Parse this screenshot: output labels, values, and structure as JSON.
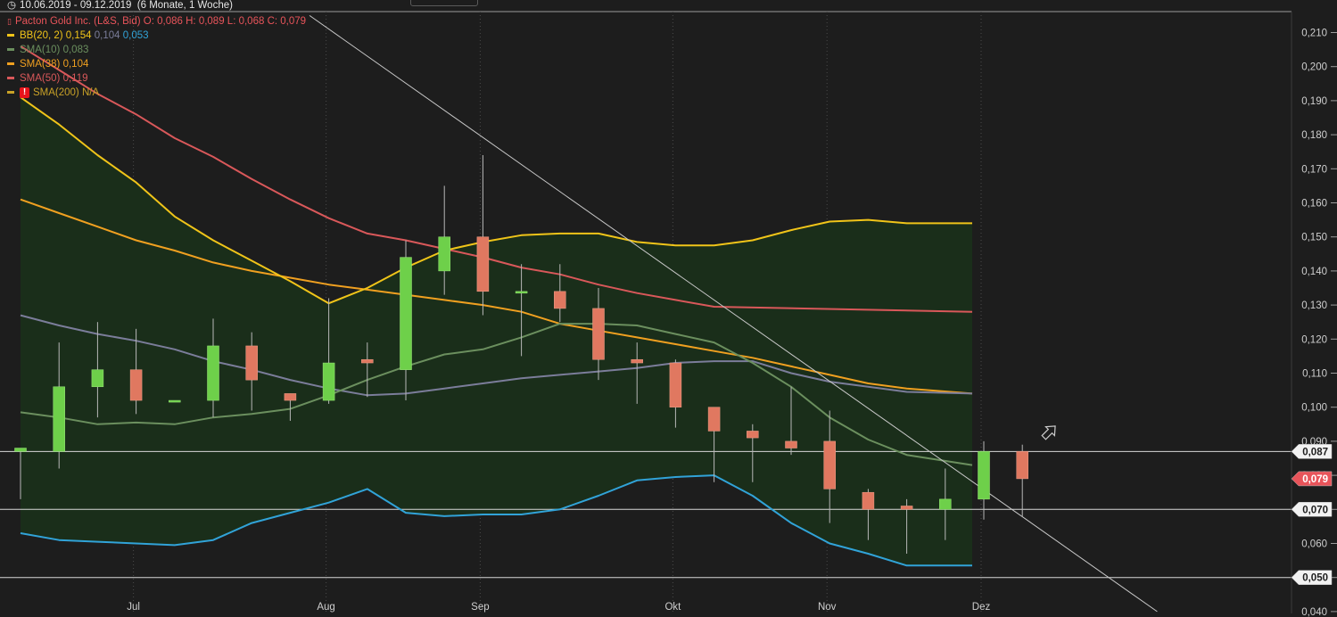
{
  "header": {
    "range_text": "10.06.2019 - 09.12.2019",
    "period_text": "(6 Monate, 1 Woche)"
  },
  "legend": {
    "instrument": {
      "name": "Pacton Gold Inc. (L&S, Bid)",
      "o_label": "O:",
      "o": "0,086",
      "h_label": "H:",
      "h": "0,089",
      "l_label": "L:",
      "l": "0,068",
      "c_label": "C:",
      "c": "0,079",
      "color": "#e8545a"
    },
    "bb": {
      "name": "BB(20, 2)",
      "v1": "0,154",
      "v2": "0,104",
      "v3": "0,053",
      "c1": "#f0c419",
      "c2": "#7b7d9a",
      "c3": "#31a3d8"
    },
    "sma10": {
      "name": "SMA(10)",
      "value": "0,083",
      "color": "#6b8f5e"
    },
    "sma38": {
      "name": "SMA(38)",
      "value": "0,104",
      "color": "#f0a020"
    },
    "sma50": {
      "name": "SMA(50)",
      "value": "0,119",
      "color": "#d9585a"
    },
    "sma200": {
      "name": "SMA(200)",
      "value": "N/A",
      "color": "#c9a227",
      "warn_icon": "!"
    }
  },
  "chart_data": {
    "type": "candlestick",
    "ylim": [
      0.04,
      0.215
    ],
    "y_ticks": [
      "0,210",
      "0,200",
      "0,190",
      "0,180",
      "0,170",
      "0,160",
      "0,150",
      "0,140",
      "0,130",
      "0,120",
      "0,110",
      "0,100",
      "0,090",
      "0,080",
      "0,070",
      "0,060",
      "0,050",
      "0,040"
    ],
    "y_tick_values": [
      0.21,
      0.2,
      0.19,
      0.18,
      0.17,
      0.16,
      0.15,
      0.14,
      0.13,
      0.12,
      0.11,
      0.1,
      0.09,
      0.08,
      0.07,
      0.06,
      0.05,
      0.04
    ],
    "x_labels": [
      {
        "label": "Jul",
        "index": 3.0
      },
      {
        "label": "Aug",
        "index": 8.0
      },
      {
        "label": "Sep",
        "index": 12.0
      },
      {
        "label": "Okt",
        "index": 17.0
      },
      {
        "label": "Nov",
        "index": 21.0
      },
      {
        "label": "Dez",
        "index": 25.0
      }
    ],
    "candles": [
      {
        "o": 0.087,
        "h": 0.088,
        "l": 0.073,
        "c": 0.088
      },
      {
        "o": 0.087,
        "h": 0.119,
        "l": 0.082,
        "c": 0.106
      },
      {
        "o": 0.106,
        "h": 0.125,
        "l": 0.097,
        "c": 0.111
      },
      {
        "o": 0.111,
        "h": 0.123,
        "l": 0.098,
        "c": 0.102
      },
      {
        "o": 0.102,
        "h": 0.102,
        "l": 0.102,
        "c": 0.102
      },
      {
        "o": 0.102,
        "h": 0.126,
        "l": 0.097,
        "c": 0.118
      },
      {
        "o": 0.118,
        "h": 0.122,
        "l": 0.099,
        "c": 0.108
      },
      {
        "o": 0.104,
        "h": 0.104,
        "l": 0.096,
        "c": 0.102
      },
      {
        "o": 0.102,
        "h": 0.132,
        "l": 0.101,
        "c": 0.113
      },
      {
        "o": 0.114,
        "h": 0.119,
        "l": 0.103,
        "c": 0.113
      },
      {
        "o": 0.111,
        "h": 0.149,
        "l": 0.102,
        "c": 0.144
      },
      {
        "o": 0.14,
        "h": 0.165,
        "l": 0.133,
        "c": 0.15
      },
      {
        "o": 0.15,
        "h": 0.174,
        "l": 0.127,
        "c": 0.134
      },
      {
        "o": 0.134,
        "h": 0.142,
        "l": 0.115,
        "c": 0.134
      },
      {
        "o": 0.134,
        "h": 0.142,
        "l": 0.125,
        "c": 0.129
      },
      {
        "o": 0.129,
        "h": 0.135,
        "l": 0.108,
        "c": 0.114
      },
      {
        "o": 0.114,
        "h": 0.119,
        "l": 0.101,
        "c": 0.113
      },
      {
        "o": 0.113,
        "h": 0.114,
        "l": 0.094,
        "c": 0.1
      },
      {
        "o": 0.1,
        "h": 0.1,
        "l": 0.078,
        "c": 0.093
      },
      {
        "o": 0.093,
        "h": 0.095,
        "l": 0.078,
        "c": 0.091
      },
      {
        "o": 0.09,
        "h": 0.106,
        "l": 0.086,
        "c": 0.088
      },
      {
        "o": 0.09,
        "h": 0.099,
        "l": 0.066,
        "c": 0.076
      },
      {
        "o": 0.075,
        "h": 0.076,
        "l": 0.061,
        "c": 0.07
      },
      {
        "o": 0.071,
        "h": 0.073,
        "l": 0.057,
        "c": 0.07
      },
      {
        "o": 0.07,
        "h": 0.082,
        "l": 0.061,
        "c": 0.073
      },
      {
        "o": 0.073,
        "h": 0.09,
        "l": 0.067,
        "c": 0.087
      },
      {
        "o": 0.087,
        "h": 0.089,
        "l": 0.068,
        "c": 0.079
      }
    ],
    "bb_upper": [
      0.191,
      0.183,
      0.174,
      0.166,
      0.156,
      0.149,
      0.143,
      0.137,
      0.1305,
      0.135,
      0.141,
      0.146,
      0.1485,
      0.1505,
      0.151,
      0.151,
      0.1485,
      0.1475,
      0.1475,
      0.149,
      0.152,
      0.1545,
      0.155,
      0.154,
      0.154
    ],
    "bb_upper_x": [
      0,
      1,
      2,
      3,
      4,
      5,
      6,
      7,
      8,
      9,
      10,
      11,
      12,
      13,
      14,
      15,
      16,
      17,
      18,
      19,
      20,
      21,
      22,
      23,
      24.7
    ],
    "bb_mid": [
      0.127,
      0.124,
      0.1215,
      0.1195,
      0.117,
      0.1135,
      0.111,
      0.108,
      0.1055,
      0.1035,
      0.104,
      0.1055,
      0.107,
      0.1085,
      0.1095,
      0.1105,
      0.1115,
      0.113,
      0.1135,
      0.1135,
      0.11,
      0.1075,
      0.106,
      0.1045,
      0.104
    ],
    "bb_mid_x": [
      0,
      1,
      2,
      3,
      4,
      5,
      6,
      7,
      8,
      9,
      10,
      11,
      12,
      13,
      14,
      15,
      16,
      17,
      18,
      19,
      20,
      21,
      22,
      23,
      24.7
    ],
    "bb_lower": [
      0.063,
      0.061,
      0.0605,
      0.06,
      0.0595,
      0.061,
      0.066,
      0.069,
      0.072,
      0.076,
      0.069,
      0.068,
      0.0685,
      0.0685,
      0.07,
      0.074,
      0.0785,
      0.0795,
      0.08,
      0.074,
      0.066,
      0.06,
      0.057,
      0.0535,
      0.0535
    ],
    "bb_lower_x": [
      0,
      1,
      2,
      3,
      4,
      5,
      6,
      7,
      8,
      9,
      10,
      11,
      12,
      13,
      14,
      15,
      16,
      17,
      18,
      19,
      20,
      21,
      22,
      23,
      24.7
    ],
    "sma10": [
      0.0985,
      0.097,
      0.095,
      0.0955,
      0.095,
      0.097,
      0.098,
      0.0995,
      0.1035,
      0.108,
      0.112,
      0.1155,
      0.117,
      0.1205,
      0.1245,
      0.1245,
      0.124,
      0.1215,
      0.119,
      0.113,
      0.106,
      0.097,
      0.0905,
      0.086,
      0.083
    ],
    "sma10_x": [
      0,
      1,
      2,
      3,
      4,
      5,
      6,
      7,
      8,
      9,
      10,
      11,
      12,
      13,
      14,
      15,
      16,
      17,
      18,
      19,
      20,
      21,
      22,
      23,
      24.7
    ],
    "sma38": [
      0.161,
      0.157,
      0.153,
      0.149,
      0.146,
      0.1425,
      0.14,
      0.138,
      0.136,
      0.1345,
      0.133,
      0.1315,
      0.13,
      0.128,
      0.1245,
      0.1225,
      0.1205,
      0.1185,
      0.1165,
      0.1145,
      0.112,
      0.1095,
      0.107,
      0.1055,
      0.104
    ],
    "sma38_x": [
      0,
      1,
      2,
      3,
      4,
      5,
      6,
      7,
      8,
      9,
      10,
      11,
      12,
      13,
      14,
      15,
      16,
      17,
      18,
      19,
      20,
      21,
      22,
      23,
      24.7
    ],
    "sma50": [
      0.206,
      0.199,
      0.192,
      0.186,
      0.179,
      0.1735,
      0.167,
      0.161,
      0.1555,
      0.151,
      0.149,
      0.1465,
      0.144,
      0.141,
      0.139,
      0.136,
      0.1335,
      0.1315,
      0.1295,
      0.128,
      0.1245,
      0.1225,
      0.1205,
      0.119
    ],
    "sma50_x": [
      0,
      1,
      2,
      3,
      4,
      5,
      6,
      7,
      8,
      9,
      10,
      11,
      12,
      13,
      14,
      15,
      16,
      17,
      18,
      24.7
    ],
    "trendline": {
      "x": [
        7.5,
        29.5
      ],
      "y": [
        0.215,
        0.04
      ]
    },
    "hlines": [
      {
        "value": 0.087,
        "label": "0,087"
      },
      {
        "value": 0.07,
        "label": "0,070"
      },
      {
        "value": 0.05,
        "label": "0,050"
      }
    ],
    "last_price": {
      "value": 0.079,
      "label": "0,079"
    },
    "colors": {
      "up": "#6ed04a",
      "down": "#e07860",
      "wick": "#b8b8b8",
      "bg": "#1d1d1d",
      "band_fill": "#1a2e1a",
      "bb_upper": "#f0c419",
      "bb_mid": "#7b7d9a",
      "bb_lower": "#31a3d8",
      "sma10": "#6b8f5e",
      "sma38": "#f0a020",
      "sma50": "#d9585a",
      "last_label_bg": "#e8545a",
      "hline": "#d8d8d8",
      "trend": "#c8c8c8",
      "axis_text": "#cfcfcf"
    }
  }
}
